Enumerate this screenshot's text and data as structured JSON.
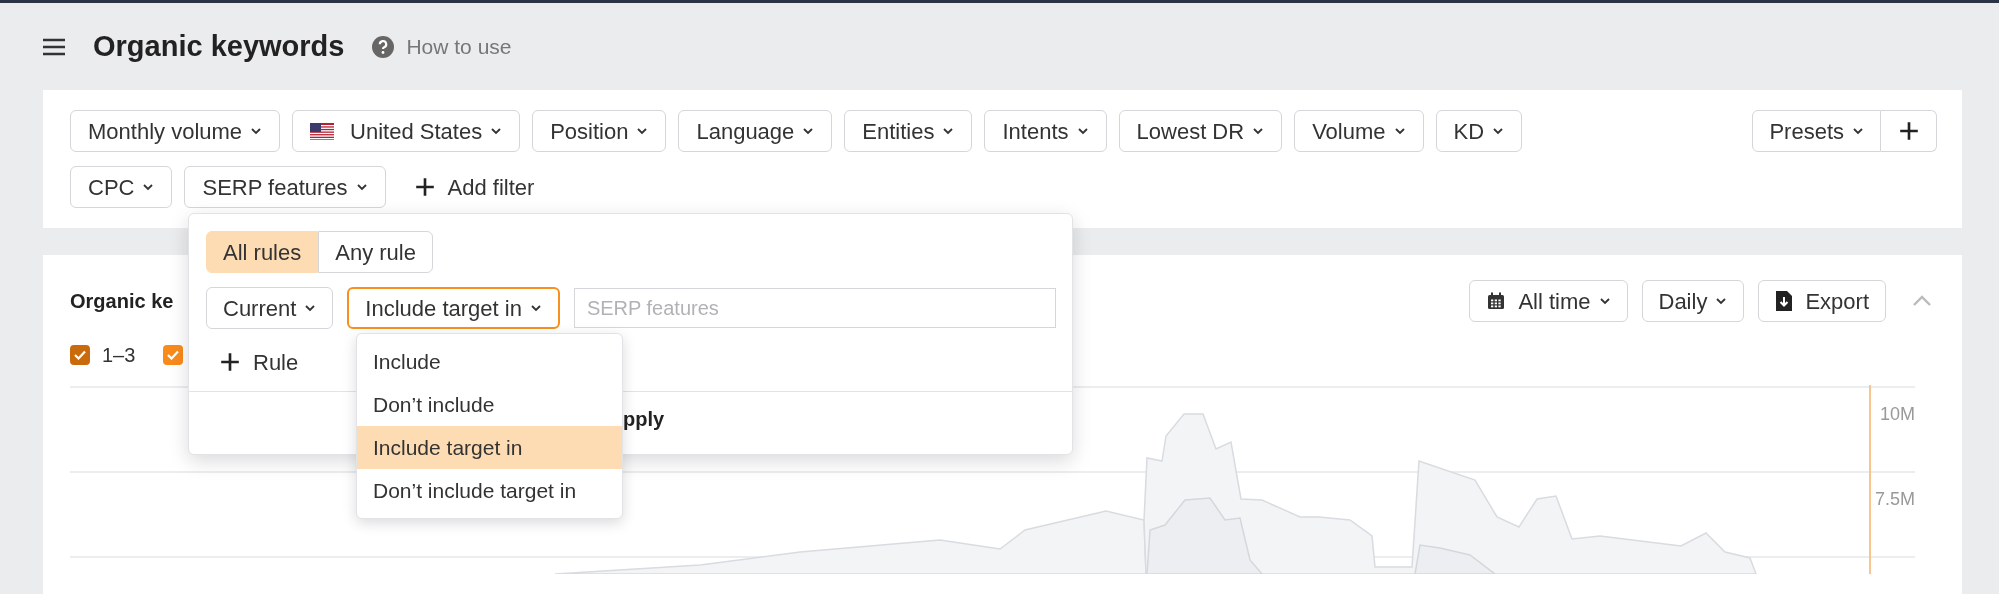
{
  "header": {
    "title": "Organic keywords",
    "help_link": "How to use"
  },
  "filters": [
    {
      "label": "Monthly volume",
      "kind": "select"
    },
    {
      "label": "United States",
      "kind": "country"
    },
    {
      "label": "Position",
      "kind": "select"
    },
    {
      "label": "Language",
      "kind": "select"
    },
    {
      "label": "Entities",
      "kind": "select"
    },
    {
      "label": "Intents",
      "kind": "select"
    },
    {
      "label": "Lowest DR",
      "kind": "select"
    },
    {
      "label": "Volume",
      "kind": "select"
    },
    {
      "label": "KD",
      "kind": "select"
    },
    {
      "label": "CPC",
      "kind": "select"
    },
    {
      "label": "SERP features",
      "kind": "select"
    }
  ],
  "add_filter": "Add filter",
  "presets": "Presets",
  "panel": {
    "title": "Organic ke",
    "controls": [
      {
        "label": "All time",
        "kind": "date"
      },
      {
        "label": "Daily",
        "kind": "select"
      },
      {
        "label": "Export",
        "kind": "export"
      }
    ],
    "legend": [
      {
        "label": "1–3",
        "checked": true,
        "color": "#c96a0c"
      },
      {
        "checked": true,
        "color": "#f98b1c"
      }
    ],
    "axis_labels": [
      "10M",
      "7.5M"
    ]
  },
  "popup": {
    "match_tabs": [
      {
        "label": "All rules",
        "selected": true
      },
      {
        "label": "Any rule",
        "selected": false
      }
    ],
    "scope": "Current",
    "condition": "Include target in",
    "value_placeholder": "SERP features",
    "add_rule": "Rule",
    "apply": "pply",
    "menu": [
      {
        "label": "Include",
        "selected": false
      },
      {
        "label": "Don’t include",
        "selected": false
      },
      {
        "label": "Include target in",
        "selected": true
      },
      {
        "label": "Don’t include target in",
        "selected": false
      }
    ]
  }
}
